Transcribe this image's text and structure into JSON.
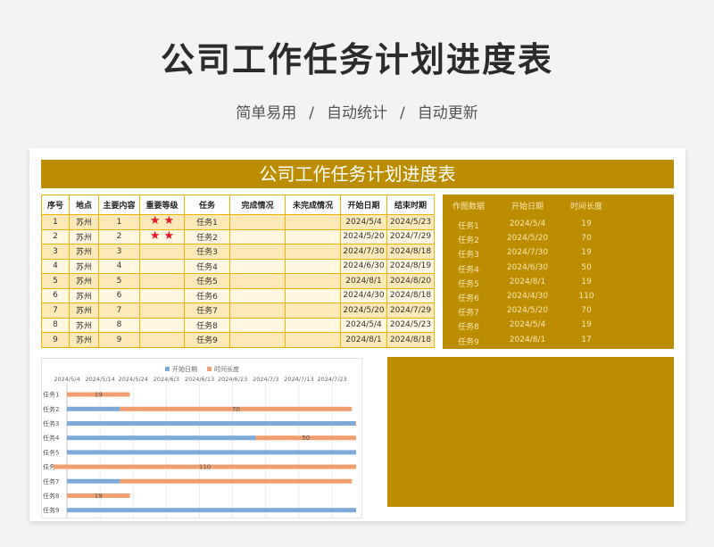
{
  "header": {
    "title": "公司工作任务计划进度表",
    "tags": [
      "简单易用",
      "自动统计",
      "自动更新"
    ],
    "separator": "/"
  },
  "sheet": {
    "banner_title": "公司工作任务计划进度表",
    "columns": [
      "序号",
      "地点",
      "主要内容",
      "重要等级",
      "任务",
      "完成情况",
      "未完成情况",
      "开始日期",
      "结束时期"
    ],
    "rows": [
      {
        "no": "1",
        "place": "苏州",
        "content": "1",
        "stars": 2,
        "task": "任务1",
        "done": "",
        "undone": "",
        "start": "2024/5/4",
        "end": "2024/5/23"
      },
      {
        "no": "2",
        "place": "苏州",
        "content": "2",
        "stars": 2,
        "task": "任务2",
        "done": "",
        "undone": "",
        "start": "2024/5/20",
        "end": "2024/7/29"
      },
      {
        "no": "3",
        "place": "苏州",
        "content": "3",
        "stars": 0,
        "task": "任务3",
        "done": "",
        "undone": "",
        "start": "2024/7/30",
        "end": "2024/8/18"
      },
      {
        "no": "4",
        "place": "苏州",
        "content": "4",
        "stars": 0,
        "task": "任务4",
        "done": "",
        "undone": "",
        "start": "2024/6/30",
        "end": "2024/8/19"
      },
      {
        "no": "5",
        "place": "苏州",
        "content": "5",
        "stars": 0,
        "task": "任务5",
        "done": "",
        "undone": "",
        "start": "2024/8/1",
        "end": "2024/8/20"
      },
      {
        "no": "6",
        "place": "苏州",
        "content": "6",
        "stars": 0,
        "task": "任务6",
        "done": "",
        "undone": "",
        "start": "2024/4/30",
        "end": "2024/8/18"
      },
      {
        "no": "7",
        "place": "苏州",
        "content": "7",
        "stars": 0,
        "task": "任务7",
        "done": "",
        "undone": "",
        "start": "2024/5/20",
        "end": "2024/7/29"
      },
      {
        "no": "8",
        "place": "苏州",
        "content": "8",
        "stars": 0,
        "task": "任务8",
        "done": "",
        "undone": "",
        "start": "2024/5/4",
        "end": "2024/5/23"
      },
      {
        "no": "9",
        "place": "苏州",
        "content": "9",
        "stars": 0,
        "task": "任务9",
        "done": "",
        "undone": "",
        "start": "2024/8/1",
        "end": "2024/8/18"
      }
    ],
    "star_glyph": "★",
    "star_color": "#e8182c"
  },
  "chart_source": {
    "headers": [
      "作图数据",
      "开始日期",
      "时间长度"
    ],
    "rows": [
      [
        "任务1",
        "2024/5/4",
        "19"
      ],
      [
        "任务2",
        "2024/5/20",
        "70"
      ],
      [
        "任务3",
        "2024/7/30",
        "19"
      ],
      [
        "任务4",
        "2024/6/30",
        "50"
      ],
      [
        "任务5",
        "2024/8/1",
        "19"
      ],
      [
        "任务6",
        "2024/4/30",
        "110"
      ],
      [
        "任务7",
        "2024/5/20",
        "70"
      ],
      [
        "任务8",
        "2024/5/4",
        "19"
      ],
      [
        "任务9",
        "2024/8/1",
        "17"
      ]
    ]
  },
  "colors": {
    "gold": "#bd8d00",
    "start_series": "#7ea9d8",
    "length_series": "#f0a070",
    "table_border": "#f0b400"
  },
  "chart_data": {
    "type": "bar",
    "orientation": "horizontal-stacked",
    "legend": [
      "开始日期",
      "时间长度"
    ],
    "legend_position": "top",
    "x_ticks": [
      "2024/5/4",
      "2024/5/14",
      "2024/5/24",
      "2024/6/3",
      "2024/6/13",
      "2024/6/23",
      "2024/7/3",
      "2024/7/13",
      "2024/7/23"
    ],
    "xlim": [
      "2024/5/4",
      "2024/7/23"
    ],
    "categories": [
      "任务1",
      "任务2",
      "任务3",
      "任务4",
      "任务5",
      "任务6",
      "任务7",
      "任务8",
      "任务9"
    ],
    "series": [
      {
        "name": "开始日期",
        "values": [
          "2024/5/4",
          "2024/5/20",
          "2024/7/30",
          "2024/6/30",
          "2024/8/1",
          "2024/4/30",
          "2024/5/20",
          "2024/5/4",
          "2024/8/1"
        ]
      },
      {
        "name": "时间长度",
        "values": [
          19,
          70,
          19,
          50,
          19,
          110,
          70,
          19,
          17
        ]
      }
    ],
    "data_labels": [
      "19",
      "70",
      "",
      "50",
      "",
      "110",
      "",
      "19",
      ""
    ],
    "grid": true
  }
}
